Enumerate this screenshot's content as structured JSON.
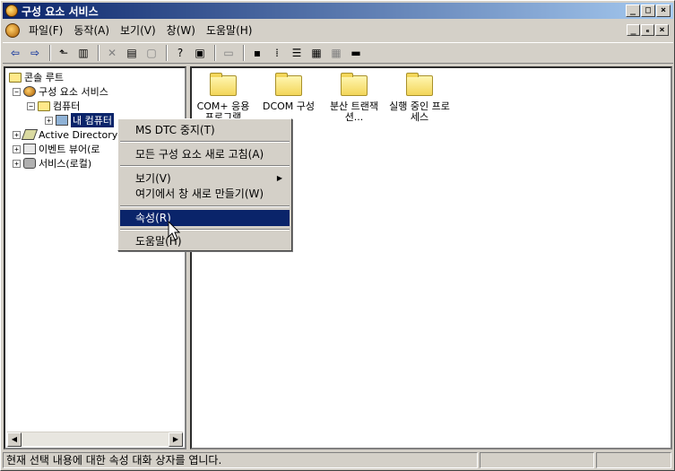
{
  "window": {
    "title": "구성 요소 서비스",
    "controls": [
      "_",
      "□",
      "×"
    ],
    "child_controls": [
      "_",
      "ₑ",
      "×"
    ]
  },
  "menubar": {
    "items": [
      {
        "label": "파일(F)"
      },
      {
        "label": "동작(A)"
      },
      {
        "label": "보기(V)"
      },
      {
        "label": "창(W)"
      },
      {
        "label": "도움말(H)"
      }
    ]
  },
  "tree": {
    "items": [
      {
        "label": "콘솔 루트"
      },
      {
        "label": "구성 요소 서비스"
      },
      {
        "label": "컴퓨터"
      },
      {
        "label": "내 컴퓨터"
      },
      {
        "label": "Active Directory"
      },
      {
        "label": "이벤트 뷰어(로"
      },
      {
        "label": "서비스(로컬)"
      }
    ]
  },
  "content": {
    "items": [
      {
        "label": "COM+ 응용 프로그램"
      },
      {
        "label": "DCOM 구성"
      },
      {
        "label": "분산 트랜잭션..."
      },
      {
        "label": "실행 중인 프로세스"
      }
    ]
  },
  "context_menu": {
    "items": [
      {
        "label": "MS DTC 중지(T)"
      },
      {
        "label": "모든 구성 요소 새로 고침(A)"
      },
      {
        "label": "보기(V)"
      },
      {
        "label": "여기에서 창 새로 만들기(W)"
      },
      {
        "label": "속성(R)"
      },
      {
        "label": "도움말(H)"
      }
    ],
    "highlighted": "속성(R)"
  },
  "statusbar": {
    "text": "현재 선택 내용에 대한 속성 대화 상자를 엽니다."
  }
}
